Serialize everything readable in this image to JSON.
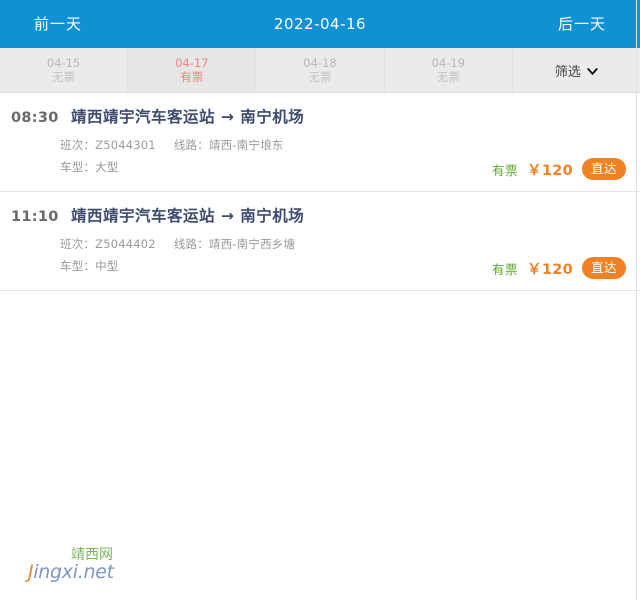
{
  "topbar": {
    "prev_day_label": "前一天",
    "current_date": "2022-04-16",
    "next_day_label": "后一天",
    "background_color": "#1191d4",
    "text_color": "#ffffff"
  },
  "date_strip": {
    "tabs": [
      {
        "date": "04-15",
        "status": "无票",
        "active": false
      },
      {
        "date": "04-17",
        "status": "有票",
        "active": true
      },
      {
        "date": "04-18",
        "status": "无票",
        "active": false
      },
      {
        "date": "04-19",
        "status": "无票",
        "active": false
      }
    ],
    "filter": {
      "label": "筛选",
      "icon": "chevron-down-icon"
    },
    "active_color": "#f1837c",
    "inactive_color": "#bdbdbd"
  },
  "trips": [
    {
      "time": "08:30",
      "route": "靖西靖宇汽车客运站 → 南宁机场",
      "schedule_label": "班次：",
      "schedule_value": "Z5044301",
      "line_label": "线路：",
      "line_value": "靖西-南宁埌东",
      "vehicle_label": "车型：",
      "vehicle_value": "大型",
      "ticket_status": "有票",
      "price": "￥120",
      "direct_label": "直达"
    },
    {
      "time": "11:10",
      "route": "靖西靖宇汽车客运站 → 南宁机场",
      "schedule_label": "班次：",
      "schedule_value": "Z5044402",
      "line_label": "线路：",
      "line_value": "靖西-南宁西乡塘",
      "vehicle_label": "车型：",
      "vehicle_value": "中型",
      "ticket_status": "有票",
      "price": "￥120",
      "direct_label": "直达"
    }
  ],
  "colors": {
    "header_blue": "#1191d4",
    "price_orange": "#f08226",
    "status_green": "#5aa828",
    "route_navy": "#3d4b6e",
    "tab_active_red": "#f1837c"
  },
  "watermark": {
    "cn_text": "靖西网",
    "en_first": "J",
    "en_rest": "ingxi.net"
  }
}
